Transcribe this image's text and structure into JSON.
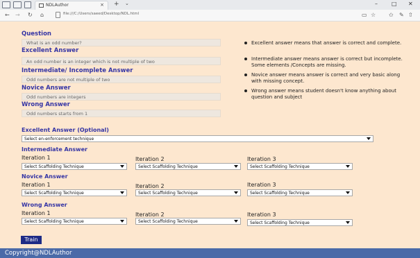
{
  "browser": {
    "tab_title": "NDLAuthor",
    "tab_close": "×",
    "new_tab": "+",
    "tab_list": "⌄",
    "url": "file:///C:/Users/saeed/Desktop/NDL.html",
    "win_min": "–",
    "win_max": "□",
    "win_close": "✕"
  },
  "question": {
    "label": "Question",
    "value": "What is an odd number?"
  },
  "excellent": {
    "label": "Excellent Answer",
    "value": "An odd number is an integer which is not multiple of two"
  },
  "intermediate": {
    "label": "Intermediate/ Incomplete Answer",
    "value": "Odd numbers are not multiple of two"
  },
  "novice": {
    "label": "Novice Answer",
    "value": "Odd numbers are integers"
  },
  "wrong": {
    "label": "Wrong Answer",
    "value": "Odd numbers starts from 1"
  },
  "bullets": [
    "Excellent answer means that answer is correct and complete.",
    "Intermediate answer means answer is correct but incomplete. Some elements /Concepts are missing.",
    "Novice  answer means answer is correct and very basic along with missing concept.",
    "Wrong answer means student  doesn't know anything about question and subject"
  ],
  "excellent_optional": {
    "label": "Excellent Answer (Optional)",
    "select": "Select en-enforcement technique"
  },
  "scaffold_sections": [
    {
      "label": "Intermediate Answer",
      "iterations": [
        {
          "label": "Iteration 1",
          "select": "Select Scaffolding Technique"
        },
        {
          "label": "Iteration 2",
          "select": "Select Scaffolding Technique"
        },
        {
          "label": "Iteration 3",
          "select": "Select Scaffolding Technique"
        }
      ]
    },
    {
      "label": "Novice Answer",
      "iterations": [
        {
          "label": "Iteration 1",
          "select": "Select Scaffolding Technique"
        },
        {
          "label": "Iteration 2",
          "select": "Select Scaffolding Technique"
        },
        {
          "label": "Iteration 3",
          "select": "Select Scaffolding Technique"
        }
      ]
    },
    {
      "label": "Wrong Answer",
      "iterations": [
        {
          "label": "Iteration 1",
          "select": "Select Scaffolding Technique"
        },
        {
          "label": "Iteration 2",
          "select": "Select Scaffolding Technique"
        },
        {
          "label": "Iteration 3",
          "select": "Select Scaffolding Technique"
        }
      ]
    }
  ],
  "train_label": "Train",
  "footer_text": "Copyright@NDLAuthor"
}
